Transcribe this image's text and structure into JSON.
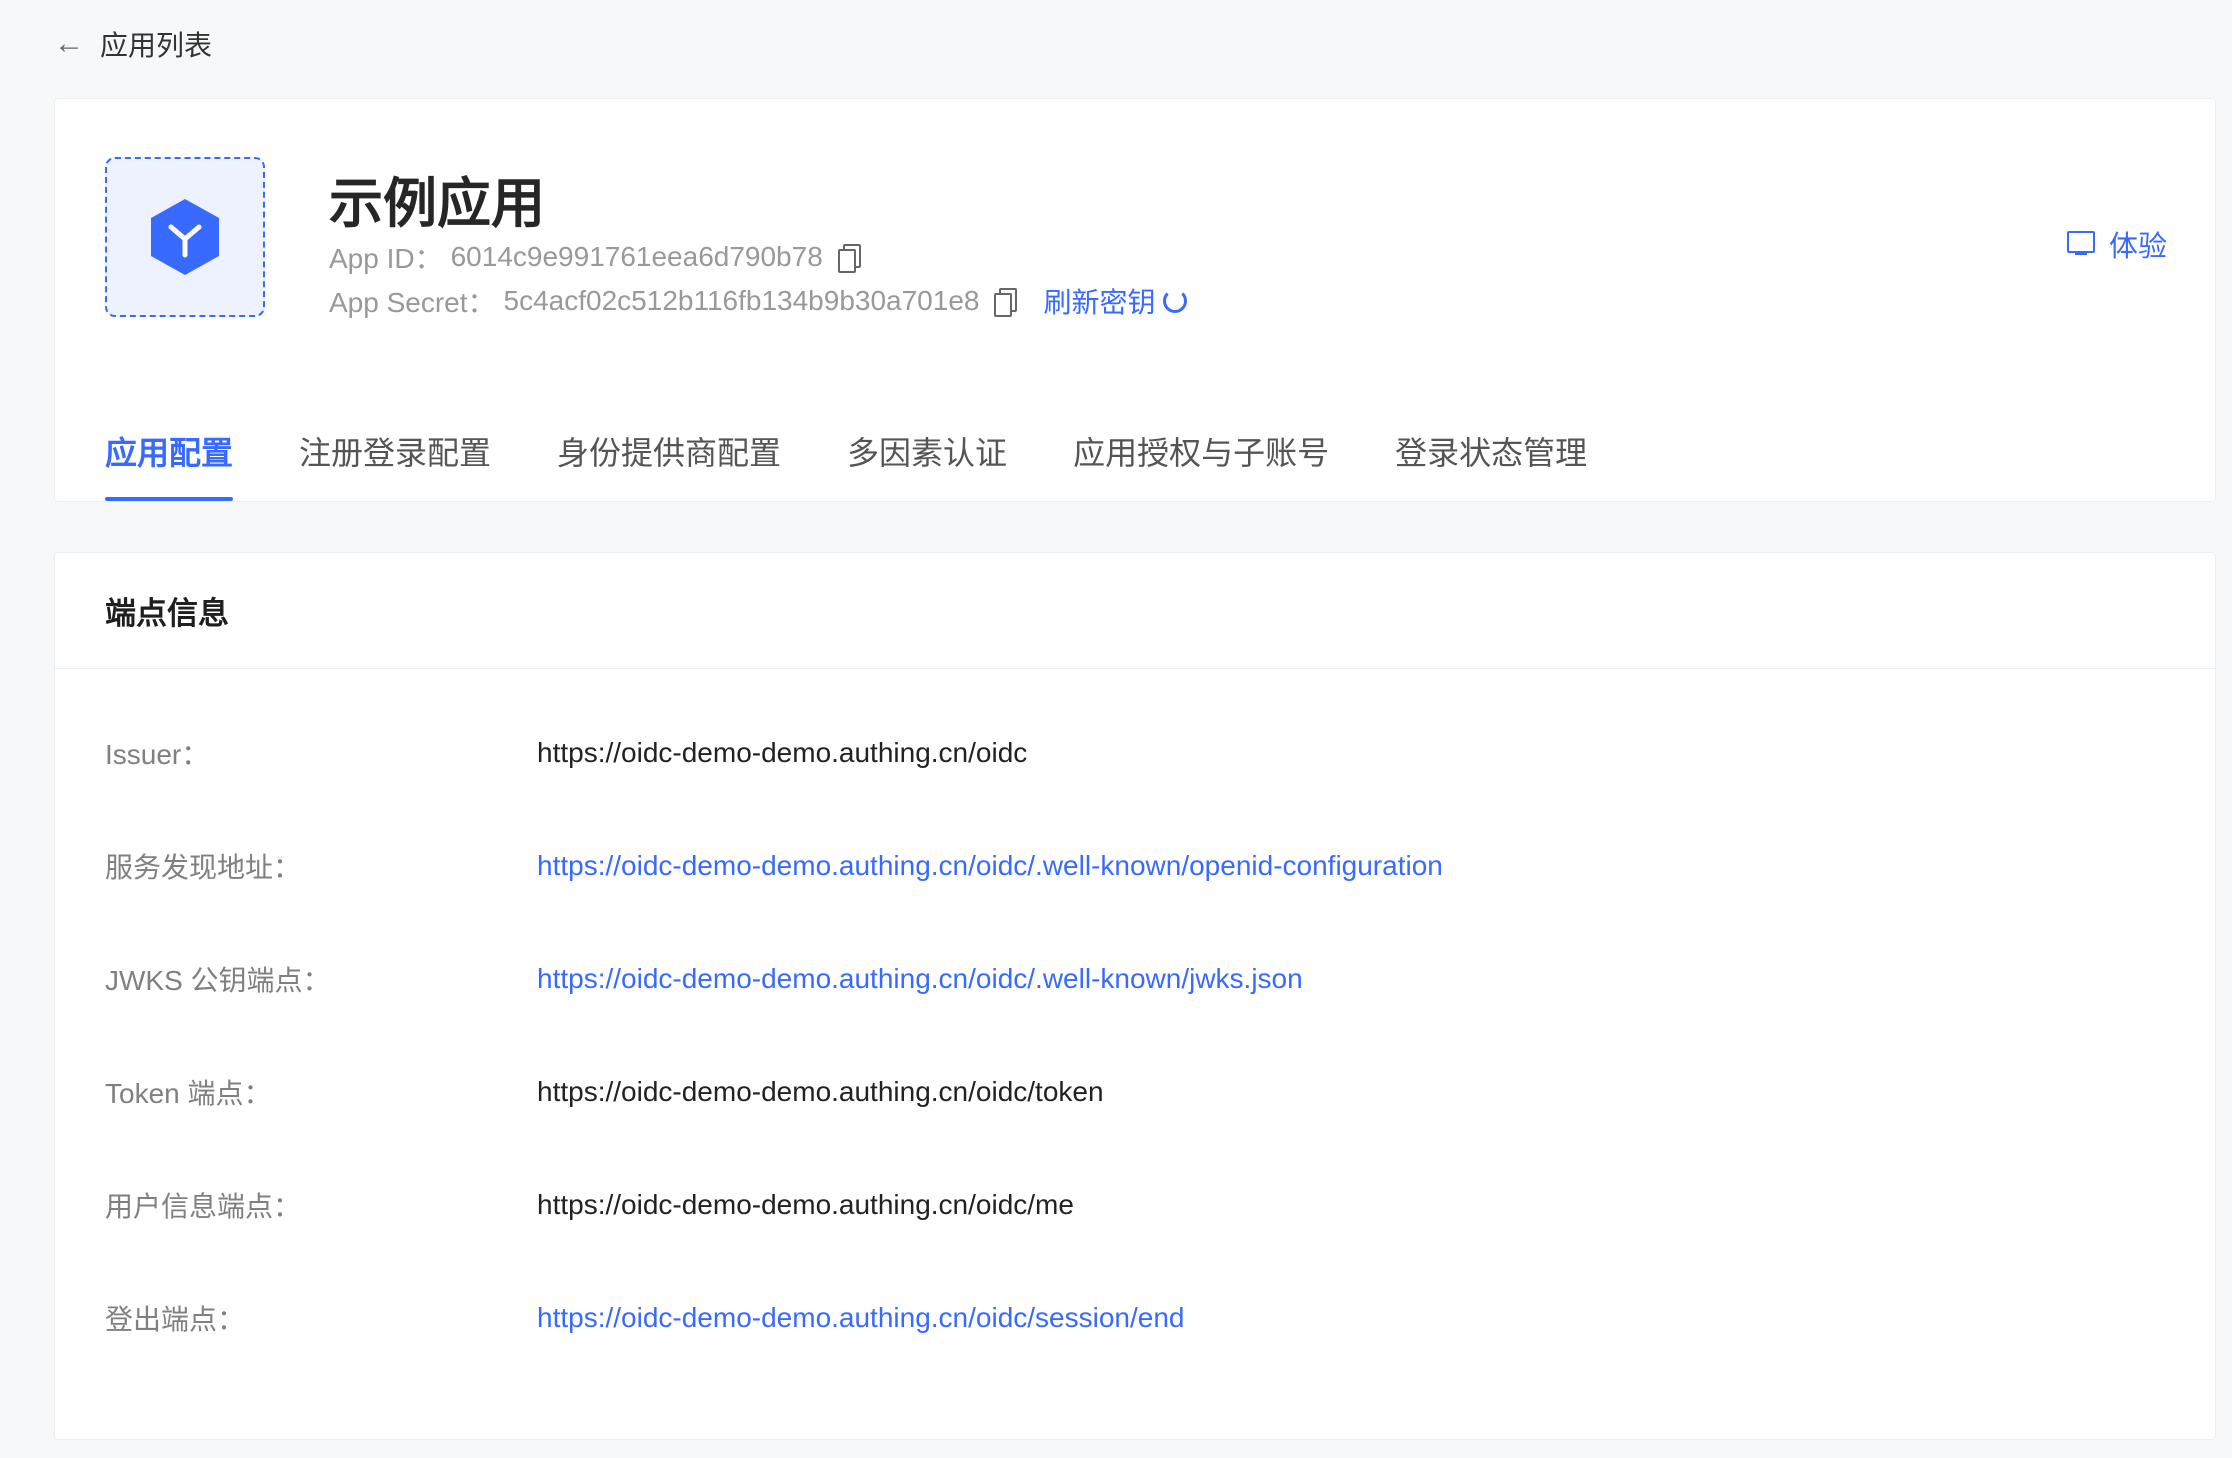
{
  "back": {
    "label": "应用列表"
  },
  "app": {
    "title": "示例应用",
    "app_id_label": "App ID：",
    "app_id": "6014c9e991761eea6d790b78",
    "secret_label": "App Secret：",
    "secret": "5c4acf02c512b116fb134b9b30a701e8",
    "refresh_label": "刷新密钥",
    "try_label": "体验"
  },
  "tabs": [
    {
      "label": "应用配置",
      "active": true
    },
    {
      "label": "注册登录配置"
    },
    {
      "label": "身份提供商配置"
    },
    {
      "label": "多因素认证"
    },
    {
      "label": "应用授权与子账号"
    },
    {
      "label": "登录状态管理"
    }
  ],
  "endpoints": {
    "title": "端点信息",
    "rows": [
      {
        "label": "Issuer：",
        "value": "https://oidc-demo-demo.authing.cn/oidc",
        "link": false
      },
      {
        "label": "服务发现地址：",
        "value": "https://oidc-demo-demo.authing.cn/oidc/.well-known/openid-configuration",
        "link": true
      },
      {
        "label": "JWKS 公钥端点：",
        "value": "https://oidc-demo-demo.authing.cn/oidc/.well-known/jwks.json",
        "link": true
      },
      {
        "label": "Token 端点：",
        "value": "https://oidc-demo-demo.authing.cn/oidc/token",
        "link": false
      },
      {
        "label": "用户信息端点：",
        "value": "https://oidc-demo-demo.authing.cn/oidc/me",
        "link": false
      },
      {
        "label": "登出端点：",
        "value": "https://oidc-demo-demo.authing.cn/oidc/session/end",
        "link": true
      }
    ]
  },
  "colors": {
    "accent": "#396aff"
  },
  "icons": {
    "back": "arrow-left-icon",
    "app": "app-cube-icon",
    "copy": "copy-icon",
    "refresh": "refresh-icon",
    "try": "monitor-icon"
  }
}
